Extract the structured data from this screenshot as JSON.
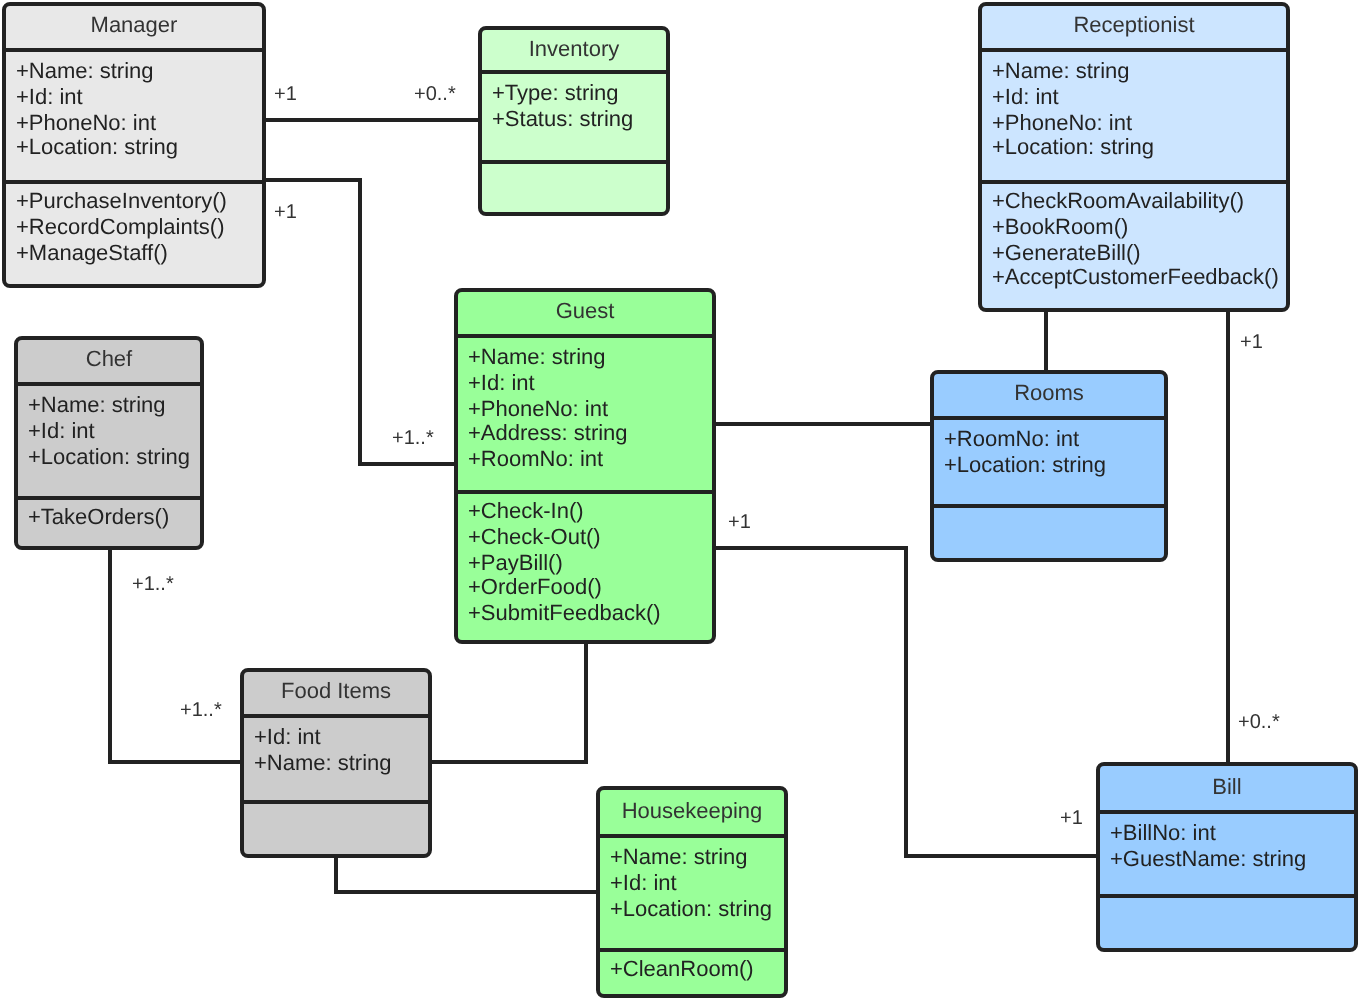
{
  "classes": [
    {
      "name": "Manager",
      "color": "#e8e8e8",
      "attributes": [
        "+Name: string",
        "+Id: int",
        "+PhoneNo: int",
        "+Location: string"
      ],
      "operations": [
        "+PurchaseInventory()",
        "+RecordComplaints()",
        "+ManageStaff()"
      ]
    },
    {
      "name": "Inventory",
      "color": "#ccffcc",
      "attributes": [
        "+Type: string",
        "+Status: string"
      ]
    },
    {
      "name": "Receptionist",
      "color": "#cce5ff",
      "attributes": [
        "+Name: string",
        "+Id: int",
        "+PhoneNo: int",
        "+Location: string"
      ],
      "operations": [
        "+CheckRoomAvailability()",
        "+BookRoom()",
        "+GenerateBill()",
        "+AcceptCustomerFeedback()"
      ]
    },
    {
      "name": "Guest",
      "color": "#99ff99",
      "attributes": [
        "+Name: string",
        "+Id: int",
        "+PhoneNo: int",
        "+Address: string",
        "+RoomNo: int"
      ],
      "operations": [
        "+Check-In()",
        "+Check-Out()",
        "+PayBill()",
        "+OrderFood()",
        "+SubmitFeedback()"
      ]
    },
    {
      "name": "Chef",
      "color": "#cccccc",
      "attributes": [
        "+Name: string",
        "+Id: int",
        "+Location: string"
      ],
      "operations": [
        "+TakeOrders()"
      ]
    },
    {
      "name": "Rooms",
      "color": "#99ccff",
      "attributes": [
        "+RoomNo: int",
        "+Location: string"
      ]
    },
    {
      "name": "Food Items",
      "color": "#cccccc",
      "attributes": [
        "+Id: int",
        "+Name: string"
      ]
    },
    {
      "name": "Housekeeping",
      "color": "#99ff99",
      "attributes": [
        "+Name: string",
        "+Id: int",
        "+Location: string"
      ],
      "operations": [
        "+CleanRoom()"
      ]
    },
    {
      "name": "Bill",
      "color": "#99ccff",
      "attributes": [
        "+BillNo: int",
        "+GuestName: string"
      ]
    }
  ],
  "multiplicity_labels": [
    "+1",
    "+0..*",
    "+1",
    "+1..*",
    "+1",
    "+0..*",
    "+1",
    "+1",
    "+1..*",
    "+1..*"
  ]
}
